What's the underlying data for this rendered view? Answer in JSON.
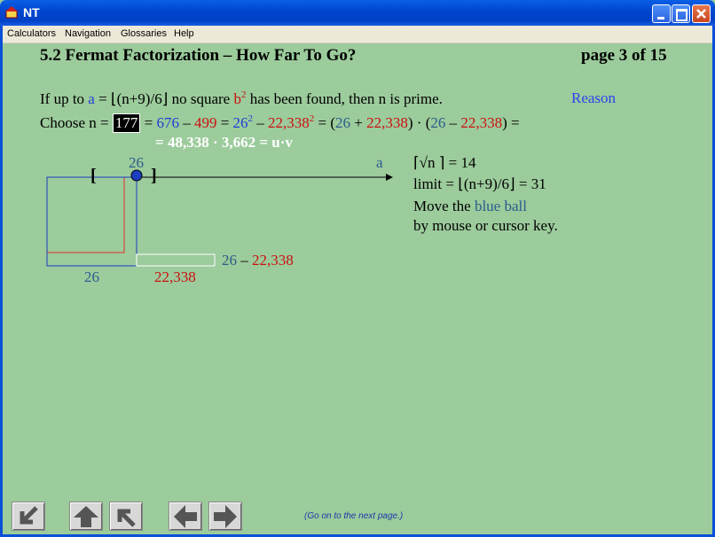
{
  "window": {
    "title": "NT"
  },
  "menu": {
    "calculators": "Calculators",
    "navigation": "Navigation",
    "glossaries": "Glossaries",
    "help": "Help"
  },
  "header": {
    "title": "5.2 Fermat Factorization – How Far To Go?",
    "page": "page 3 of 15"
  },
  "line1": {
    "p1": "If up to ",
    "a": "a",
    "p2": " = ⌊(n+9)/6⌋ no square ",
    "b2": "b",
    "sup2": "2",
    "p3": " has been found, then n is prime.",
    "reason": "Reason"
  },
  "line2": {
    "choose": "Choose n = ",
    "n": "177",
    "eq1": " = ",
    "v676": "676",
    "minus1": " – ",
    "v499": "499",
    "eq2": " = ",
    "v26": "26",
    "sq1": "2",
    "minus2": " – ",
    "v22338": "22,338",
    "sq2": "2",
    "eq3": " = (",
    "v26b": "26",
    "plus": " + ",
    "v22338b": "22,338",
    "mid": ") · (",
    "v26c": "26",
    "minus3": " – ",
    "v22338c": "22,338",
    "end": ") ="
  },
  "line3": {
    "eq": "= ",
    "u": "48,338 · 3,662 = u·v"
  },
  "diagram": {
    "ball_value": "26",
    "axis_label": "a",
    "bracket_left": "[",
    "bracket_right": "]",
    "rect_label_blue": "26",
    "rect_label_red": "22,338",
    "diff_a": "26",
    "diff_minus": " – ",
    "diff_b": "22,338"
  },
  "info": {
    "sqrt_pre": "⌈√n ⌉",
    "sqrt_val": " = 14",
    "limit": "limit = ⌊(n+9)/6⌋ = 31",
    "move1": "Move the ",
    "move_ball": "blue ball",
    "move2": "by mouse or cursor key."
  },
  "footer": {
    "text": "(Go on to the next page.)"
  },
  "colors": {
    "blue": "#1e3fd8",
    "dblue": "#2a5c8c",
    "red": "#cc1010",
    "bg": "#9ccb9c"
  }
}
